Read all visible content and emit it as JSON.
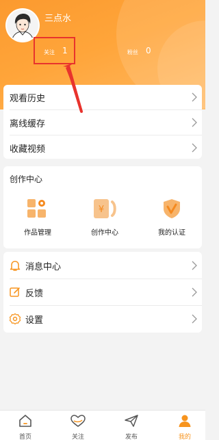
{
  "profile": {
    "username": "三点水",
    "following_label": "关注",
    "following_count": "1",
    "followers_label": "粉丝",
    "followers_count": "0"
  },
  "menu_top": [
    {
      "label": "观看历史",
      "icon": "chevron-right-icon"
    },
    {
      "label": "离线缓存",
      "icon": "chevron-right-icon"
    },
    {
      "label": "收藏视频",
      "icon": "chevron-right-icon"
    }
  ],
  "creation": {
    "title": "创作中心",
    "tools": [
      {
        "label": "作品管理",
        "icon": "works-manage-icon"
      },
      {
        "label": "创作中心",
        "icon": "creation-center-icon"
      },
      {
        "label": "我的认证",
        "icon": "verification-badge-icon"
      }
    ]
  },
  "menu_bottom": [
    {
      "label": "消息中心",
      "icon": "bell-icon"
    },
    {
      "label": "反馈",
      "icon": "edit-icon"
    },
    {
      "label": "设置",
      "icon": "gear-icon"
    }
  ],
  "nav": [
    {
      "label": "首页",
      "icon": "home-icon",
      "active": false
    },
    {
      "label": "关注",
      "icon": "heart-icon",
      "active": false
    },
    {
      "label": "发布",
      "icon": "send-icon",
      "active": false
    },
    {
      "label": "我的",
      "icon": "user-icon",
      "active": true
    }
  ],
  "colors": {
    "accent": "#f7941e",
    "header_gradient_start": "#fb9a2f",
    "highlight_box": "#e8332d"
  }
}
